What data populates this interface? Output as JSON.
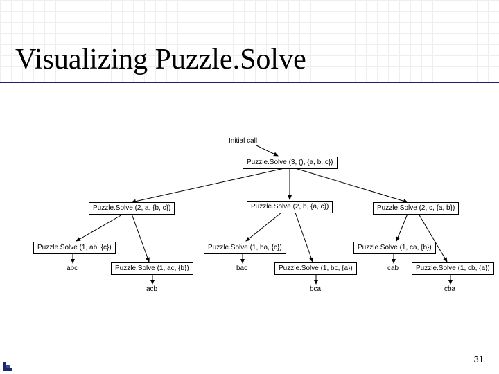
{
  "title": "Visualizing Puzzle.Solve",
  "initial_label": "Initial call",
  "root": "Puzzle.Solve (3, (), {a, b, c})",
  "level2": {
    "a": "Puzzle.Solve (2, a, {b, c})",
    "b": "Puzzle.Solve (2, b, {a, c})",
    "c": "Puzzle.Solve (2, c, {a, b})"
  },
  "level3": {
    "ab": "Puzzle.Solve (1, ab, {c})",
    "ac": "Puzzle.Solve (1, ac, {b})",
    "ba": "Puzzle.Solve (1, ba, {c})",
    "bc": "Puzzle.Solve (1, bc, {a})",
    "ca": "Puzzle.Solve (1, ca, {b})",
    "cb": "Puzzle.Solve (1, cb, {a})"
  },
  "leaves": {
    "abc": "abc",
    "acb": "acb",
    "bac": "bac",
    "bca": "bca",
    "cab": "cab",
    "cba": "cba"
  },
  "slide_number": "31"
}
